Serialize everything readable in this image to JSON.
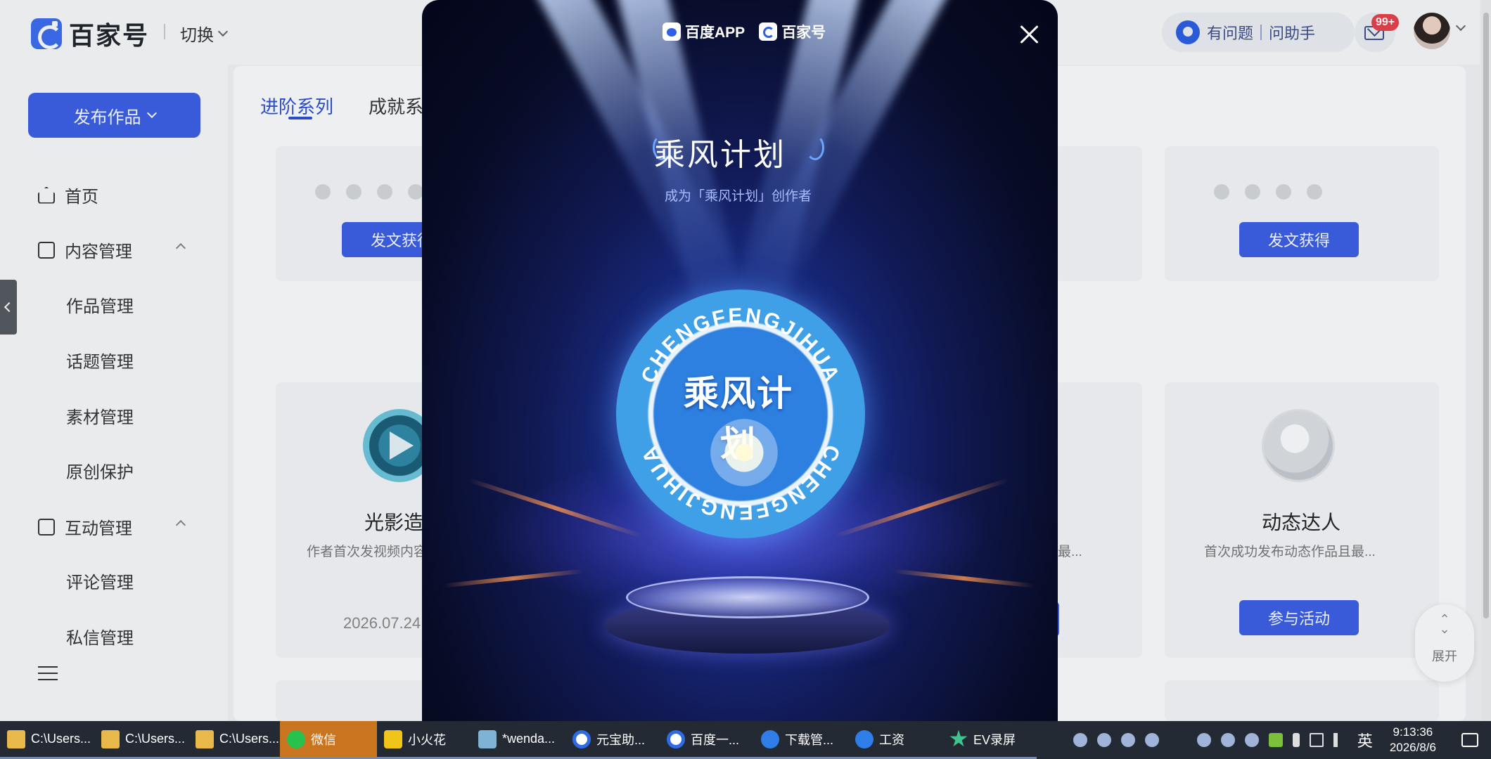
{
  "header": {
    "logo_text": "百家号",
    "switch_label": "切换",
    "help_label": "有问题",
    "help_assistant": "问助手",
    "mail_badge": "99+"
  },
  "sidebar": {
    "publish_label": "发布作品",
    "items": [
      {
        "label": "首页",
        "icon": "home-icon"
      },
      {
        "label": "内容管理",
        "icon": "document-icon"
      },
      {
        "label": "作品管理"
      },
      {
        "label": "话题管理"
      },
      {
        "label": "素材管理"
      },
      {
        "label": "原创保护"
      },
      {
        "label": "互动管理",
        "icon": "chat-icon"
      },
      {
        "label": "评论管理"
      },
      {
        "label": "私信管理"
      }
    ]
  },
  "main": {
    "tabs": [
      {
        "label": "进阶系列",
        "active": true
      },
      {
        "label": "成就系"
      }
    ],
    "cards": [
      {
        "button": "发文获得"
      },
      {
        "button": "发文获得"
      },
      {
        "title": "光影造",
        "desc": "作者首次发视频内容",
        "date": "2026.07.24"
      },
      {
        "desc_fragment": "最..."
      },
      {
        "title": "动态达人",
        "desc": "首次成功发布动态作品且最...",
        "button": "参与活动"
      }
    ],
    "expand_label": "展开"
  },
  "modal": {
    "brand_1": "百度APP",
    "brand_2": "百家号",
    "title": "乘风计划",
    "subtitle": "成为「乘风计划」创作者",
    "medal_text": "乘风计划",
    "medal_ring_top": "CHENGFENGJIHUA",
    "medal_ring_bottom": "CHENGFENGJIHUA"
  },
  "taskbar": {
    "items": [
      {
        "label": "C:\\Users...",
        "icon": "folder-icon"
      },
      {
        "label": "C:\\Users...",
        "icon": "folder-icon"
      },
      {
        "label": "C:\\Users...",
        "icon": "folder-icon"
      },
      {
        "label": "微信",
        "icon": "wechat-icon",
        "active": true
      },
      {
        "label": "小火花",
        "icon": "m-icon"
      },
      {
        "label": "*wenda...",
        "icon": "notepad-icon"
      },
      {
        "label": "元宝助...",
        "icon": "q-icon"
      },
      {
        "label": "百度一...",
        "icon": "q-icon"
      },
      {
        "label": "下载管...",
        "icon": "s-icon"
      },
      {
        "label": "工资",
        "icon": "s-icon"
      },
      {
        "label": "EV录屏",
        "icon": "ev-icon"
      }
    ],
    "ime": "英",
    "time": "9:13:36",
    "date": "2026/8/6"
  }
}
